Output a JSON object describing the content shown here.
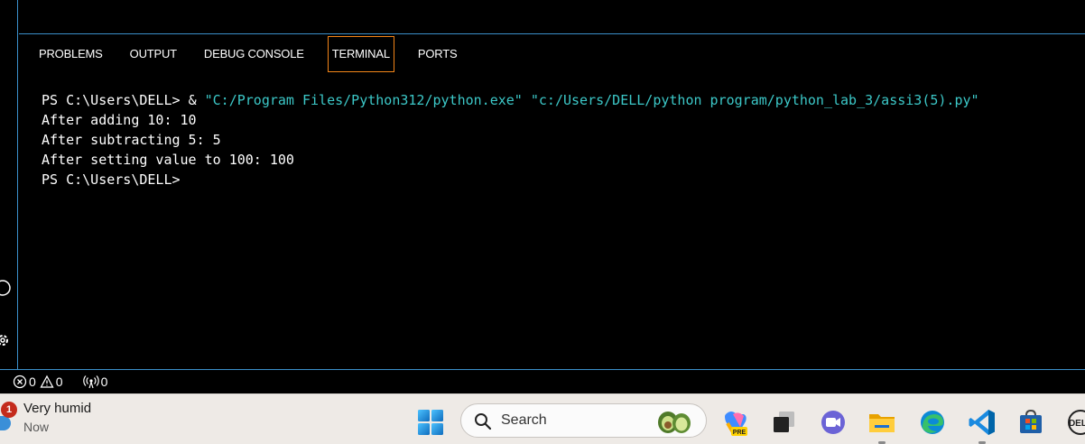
{
  "panel": {
    "tabs": [
      {
        "label": "PROBLEMS"
      },
      {
        "label": "OUTPUT"
      },
      {
        "label": "DEBUG CONSOLE"
      },
      {
        "label": "TERMINAL"
      },
      {
        "label": "PORTS"
      }
    ],
    "active_tab": "TERMINAL"
  },
  "terminal": {
    "prompt": "PS C:\\Users\\DELL> ",
    "call_operator": "& ",
    "command_exe": "\"C:/Program Files/Python312/python.exe\"",
    "command_script": "\"c:/Users/DELL/python program/python_lab_3/assi3(5).py\"",
    "output_lines": [
      "After adding 10: 10",
      "After subtracting 5: 5",
      "After setting value to 100: 100"
    ],
    "final_prompt": "PS C:\\Users\\DELL>"
  },
  "status_bar": {
    "errors": "0",
    "warnings": "0",
    "ports": "0"
  },
  "taskbar": {
    "weather": {
      "badge": "1",
      "title": "Very humid",
      "subtitle": "Now"
    },
    "search_label": "Search",
    "apps": [
      "copilot-icon",
      "task-view-icon",
      "teams-icon",
      "file-explorer-icon",
      "edge-icon",
      "vscode-icon",
      "store-icon",
      "dell-icon"
    ]
  },
  "colors": {
    "panel_border": "#3b8fc9",
    "active_tab_border": "#f38518",
    "terminal_path": "#3cc8c8",
    "taskbar_bg": "#eeeae6"
  }
}
